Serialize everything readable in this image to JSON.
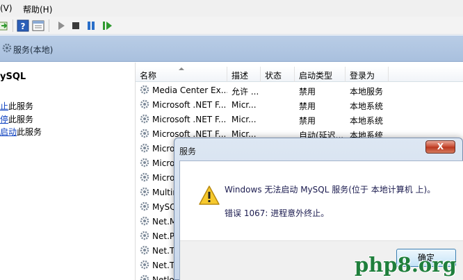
{
  "menu": {
    "items": [
      "(V)",
      "帮助(H)"
    ]
  },
  "toolbar": {
    "icons": [
      "export-icon",
      "help-icon",
      "properties-icon",
      "play-icon",
      "stop-icon",
      "pause-icon",
      "resume-icon"
    ]
  },
  "header": {
    "title": "服务(本地)"
  },
  "left_panel": {
    "service_name": "ySQL",
    "actions": [
      {
        "link": "止",
        "text": "此服务"
      },
      {
        "link": "停",
        "text": "此服务"
      },
      {
        "link": "启动",
        "text": "此服务"
      }
    ]
  },
  "list": {
    "columns": [
      "名称",
      "描述",
      "状态",
      "启动类型",
      "登录为"
    ],
    "rows": [
      {
        "name": "Media Center Ex...",
        "desc": "允许 ...",
        "status": "",
        "startup": "禁用",
        "logon": "本地服务"
      },
      {
        "name": "Microsoft .NET F...",
        "desc": "Micr...",
        "status": "",
        "startup": "禁用",
        "logon": "本地系统"
      },
      {
        "name": "Microsoft .NET F...",
        "desc": "Micr...",
        "status": "",
        "startup": "禁用",
        "logon": "本地系统"
      },
      {
        "name": "Microsoft .NET F...",
        "desc": "Micr...",
        "status": "",
        "startup": "自动(延迟...",
        "logon": "本地系统"
      },
      {
        "name": "Micro",
        "desc": "",
        "status": "",
        "startup": "",
        "logon": ""
      },
      {
        "name": "Micro",
        "desc": "",
        "status": "",
        "startup": "",
        "logon": ""
      },
      {
        "name": "Micro",
        "desc": "",
        "status": "",
        "startup": "",
        "logon": ""
      },
      {
        "name": "Multir",
        "desc": "",
        "status": "",
        "startup": "",
        "logon": ""
      },
      {
        "name": "MySQ",
        "desc": "",
        "status": "",
        "startup": "",
        "logon": ""
      },
      {
        "name": "Net.M",
        "desc": "",
        "status": "",
        "startup": "",
        "logon": ""
      },
      {
        "name": "Net.P",
        "desc": "",
        "status": "",
        "startup": "",
        "logon": ""
      },
      {
        "name": "Net.T",
        "desc": "",
        "status": "",
        "startup": "",
        "logon": ""
      },
      {
        "name": "Net.T",
        "desc": "",
        "status": "",
        "startup": "",
        "logon": ""
      },
      {
        "name": "Netlo",
        "desc": "",
        "status": "",
        "startup": "",
        "logon": ""
      }
    ]
  },
  "dialog": {
    "title": "服务",
    "close_label": "X",
    "message": "Windows 无法启动 MySQL 服务(位于 本地计算机 上)。",
    "error": "错误 1067: 进程意外终止。",
    "ok_label": "确定",
    "icon": "warning-icon"
  },
  "watermark": "php8.org",
  "colors": {
    "header": "#b9cde6",
    "link": "#0b3fbf",
    "watermark": "#1f7f3c",
    "close": "#c6472f"
  }
}
